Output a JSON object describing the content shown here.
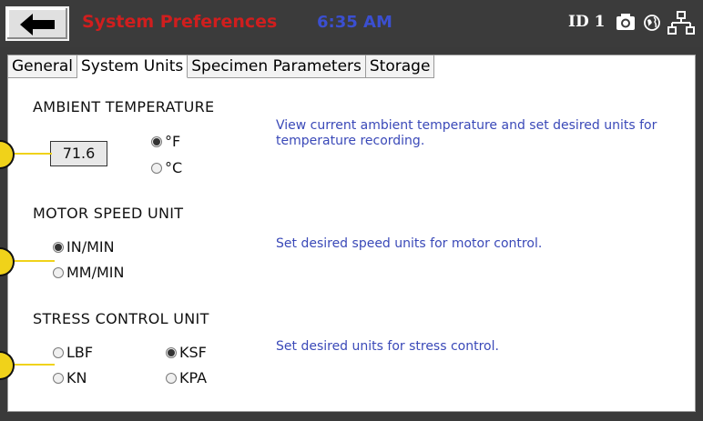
{
  "header": {
    "title": "System Preferences",
    "time": "6:35 AM",
    "id_label": "ID 1",
    "icons": [
      "back-arrow-icon",
      "camera-icon",
      "globe-icon",
      "network-icon"
    ]
  },
  "tabs": [
    {
      "label": "General",
      "active": false
    },
    {
      "label": "System Units",
      "active": true
    },
    {
      "label": "Specimen Parameters",
      "active": false
    },
    {
      "label": "Storage",
      "active": false
    }
  ],
  "ambient": {
    "title": "AMBIENT TEMPERATURE",
    "value": "71.6",
    "options": [
      {
        "label": "°F",
        "selected": true
      },
      {
        "label": "°C",
        "selected": false
      }
    ],
    "description": "View current ambient temperature and set desired units for temperature recording."
  },
  "motor": {
    "title": "MOTOR SPEED UNIT",
    "options": [
      {
        "label": "IN/MIN",
        "selected": true
      },
      {
        "label": "MM/MIN",
        "selected": false
      }
    ],
    "description": "Set desired speed units for motor control."
  },
  "stress": {
    "title": "STRESS CONTROL UNIT",
    "options": [
      {
        "label": "LBF",
        "selected": false
      },
      {
        "label": "KSF",
        "selected": true
      },
      {
        "label": "KN",
        "selected": false
      },
      {
        "label": "KPA",
        "selected": false
      }
    ],
    "description": "Set desired units for stress control."
  },
  "colors": {
    "title": "#d01e1e",
    "clock": "#3b4fd0",
    "description": "#3a49b8",
    "callout": "#f0d21a"
  }
}
